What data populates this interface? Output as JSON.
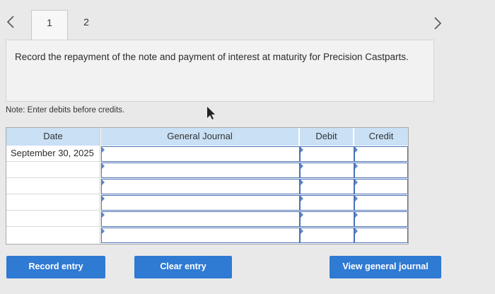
{
  "nav": {
    "tabs": [
      {
        "label": "1",
        "active": true
      },
      {
        "label": "2",
        "active": false
      }
    ],
    "prev_icon": "chevron-left-icon",
    "next_icon": "chevron-right-icon"
  },
  "question": {
    "text": "Record the repayment of the note and payment of interest at maturity for Precision Castparts."
  },
  "note": "Note: Enter debits before credits.",
  "journal": {
    "columns": [
      "Date",
      "General Journal",
      "Debit",
      "Credit"
    ],
    "rows": [
      {
        "date": "September 30, 2025",
        "account": "",
        "debit": "",
        "credit": ""
      },
      {
        "date": "",
        "account": "",
        "debit": "",
        "credit": ""
      },
      {
        "date": "",
        "account": "",
        "debit": "",
        "credit": ""
      },
      {
        "date": "",
        "account": "",
        "debit": "",
        "credit": ""
      },
      {
        "date": "",
        "account": "",
        "debit": "",
        "credit": ""
      },
      {
        "date": "",
        "account": "",
        "debit": "",
        "credit": ""
      }
    ]
  },
  "buttons": {
    "record": "Record entry",
    "clear": "Clear entry",
    "view": "View general journal"
  },
  "colors": {
    "header_bg": "#c9e0f5",
    "field_border": "#4a71b4",
    "button_bg": "#2f7ad3"
  }
}
